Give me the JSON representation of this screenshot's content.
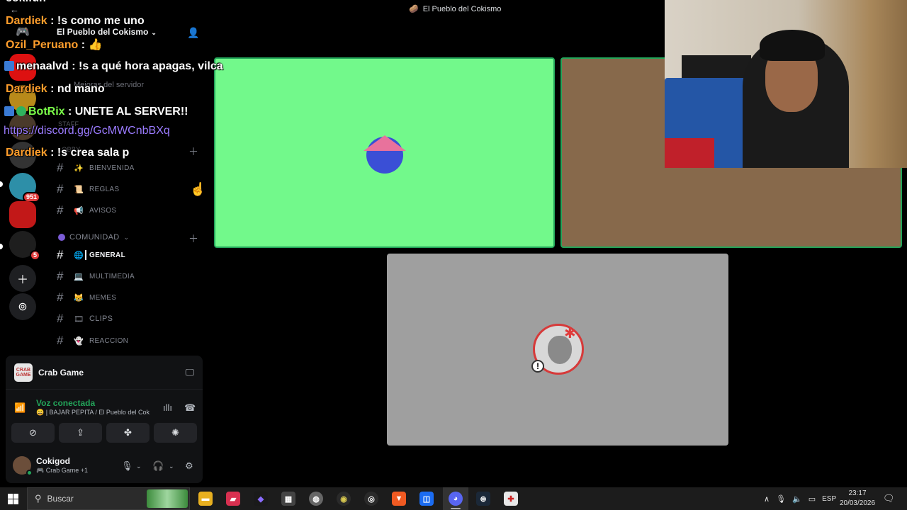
{
  "window": {
    "title": "El Pueblo del Cokismo"
  },
  "server": {
    "name": "El Pueblo del Cokismo",
    "boost_label": "Mejoras del servidor",
    "staff_label": "STAFF",
    "lobby_label": "LOBBY",
    "categories": [
      {
        "label": "COMUNIDAD"
      }
    ],
    "channels": [
      {
        "emoji": "✨",
        "label": "BIENVENIDA"
      },
      {
        "emoji": "📜",
        "label": "REGLAS"
      },
      {
        "emoji": "📢",
        "label": "AVISOS"
      },
      {
        "emoji": "🌐",
        "label": "GENERAL"
      },
      {
        "emoji": "💻",
        "label": "MULTIMEDIA"
      },
      {
        "emoji": "😹",
        "label": "MEMES"
      },
      {
        "emoji": "🎞",
        "label": "CLIPS"
      },
      {
        "emoji": "👻",
        "label": "REACCION"
      }
    ]
  },
  "rail": {
    "badges": [
      "951",
      "5"
    ]
  },
  "panel": {
    "game_icon_text": "CRAB GAME",
    "game_name": "Crab Game",
    "voice_status": "Voz conectada",
    "voice_channel": "😀 | BAJAR PEPITA / El Pueblo del Coki...",
    "username": "Cokigod",
    "user_activity": "🎮 Crab Game +1"
  },
  "chat": {
    "cut_top": "cokifun",
    "messages": [
      {
        "user": "Dardiek",
        "text": " : !s como me uno"
      },
      {
        "user": "Ozil_Peruano",
        "text": " : 👍"
      },
      {
        "user": "menaalvd",
        "text": " : !s a qué hora apagas, vilca"
      },
      {
        "user": "Dardiek",
        "text": " : nd mano"
      },
      {
        "user": "BotRix",
        "text": " : UNETE AL SERVER!!"
      },
      {
        "user": "",
        "text": "https://discord.gg/GcMWCnbBXq"
      },
      {
        "user": "Dardiek",
        "text": " : !s crea sala p"
      }
    ]
  },
  "taskbar": {
    "search_placeholder": "Buscar",
    "lang": "ESP",
    "time": "23:17",
    "date": "20/03/2026"
  },
  "colors": {
    "tile_green": "#72f98b",
    "tile_brown": "#87694b",
    "tile_gray": "#9f9f9f",
    "speaking_border": "#23a55a"
  }
}
